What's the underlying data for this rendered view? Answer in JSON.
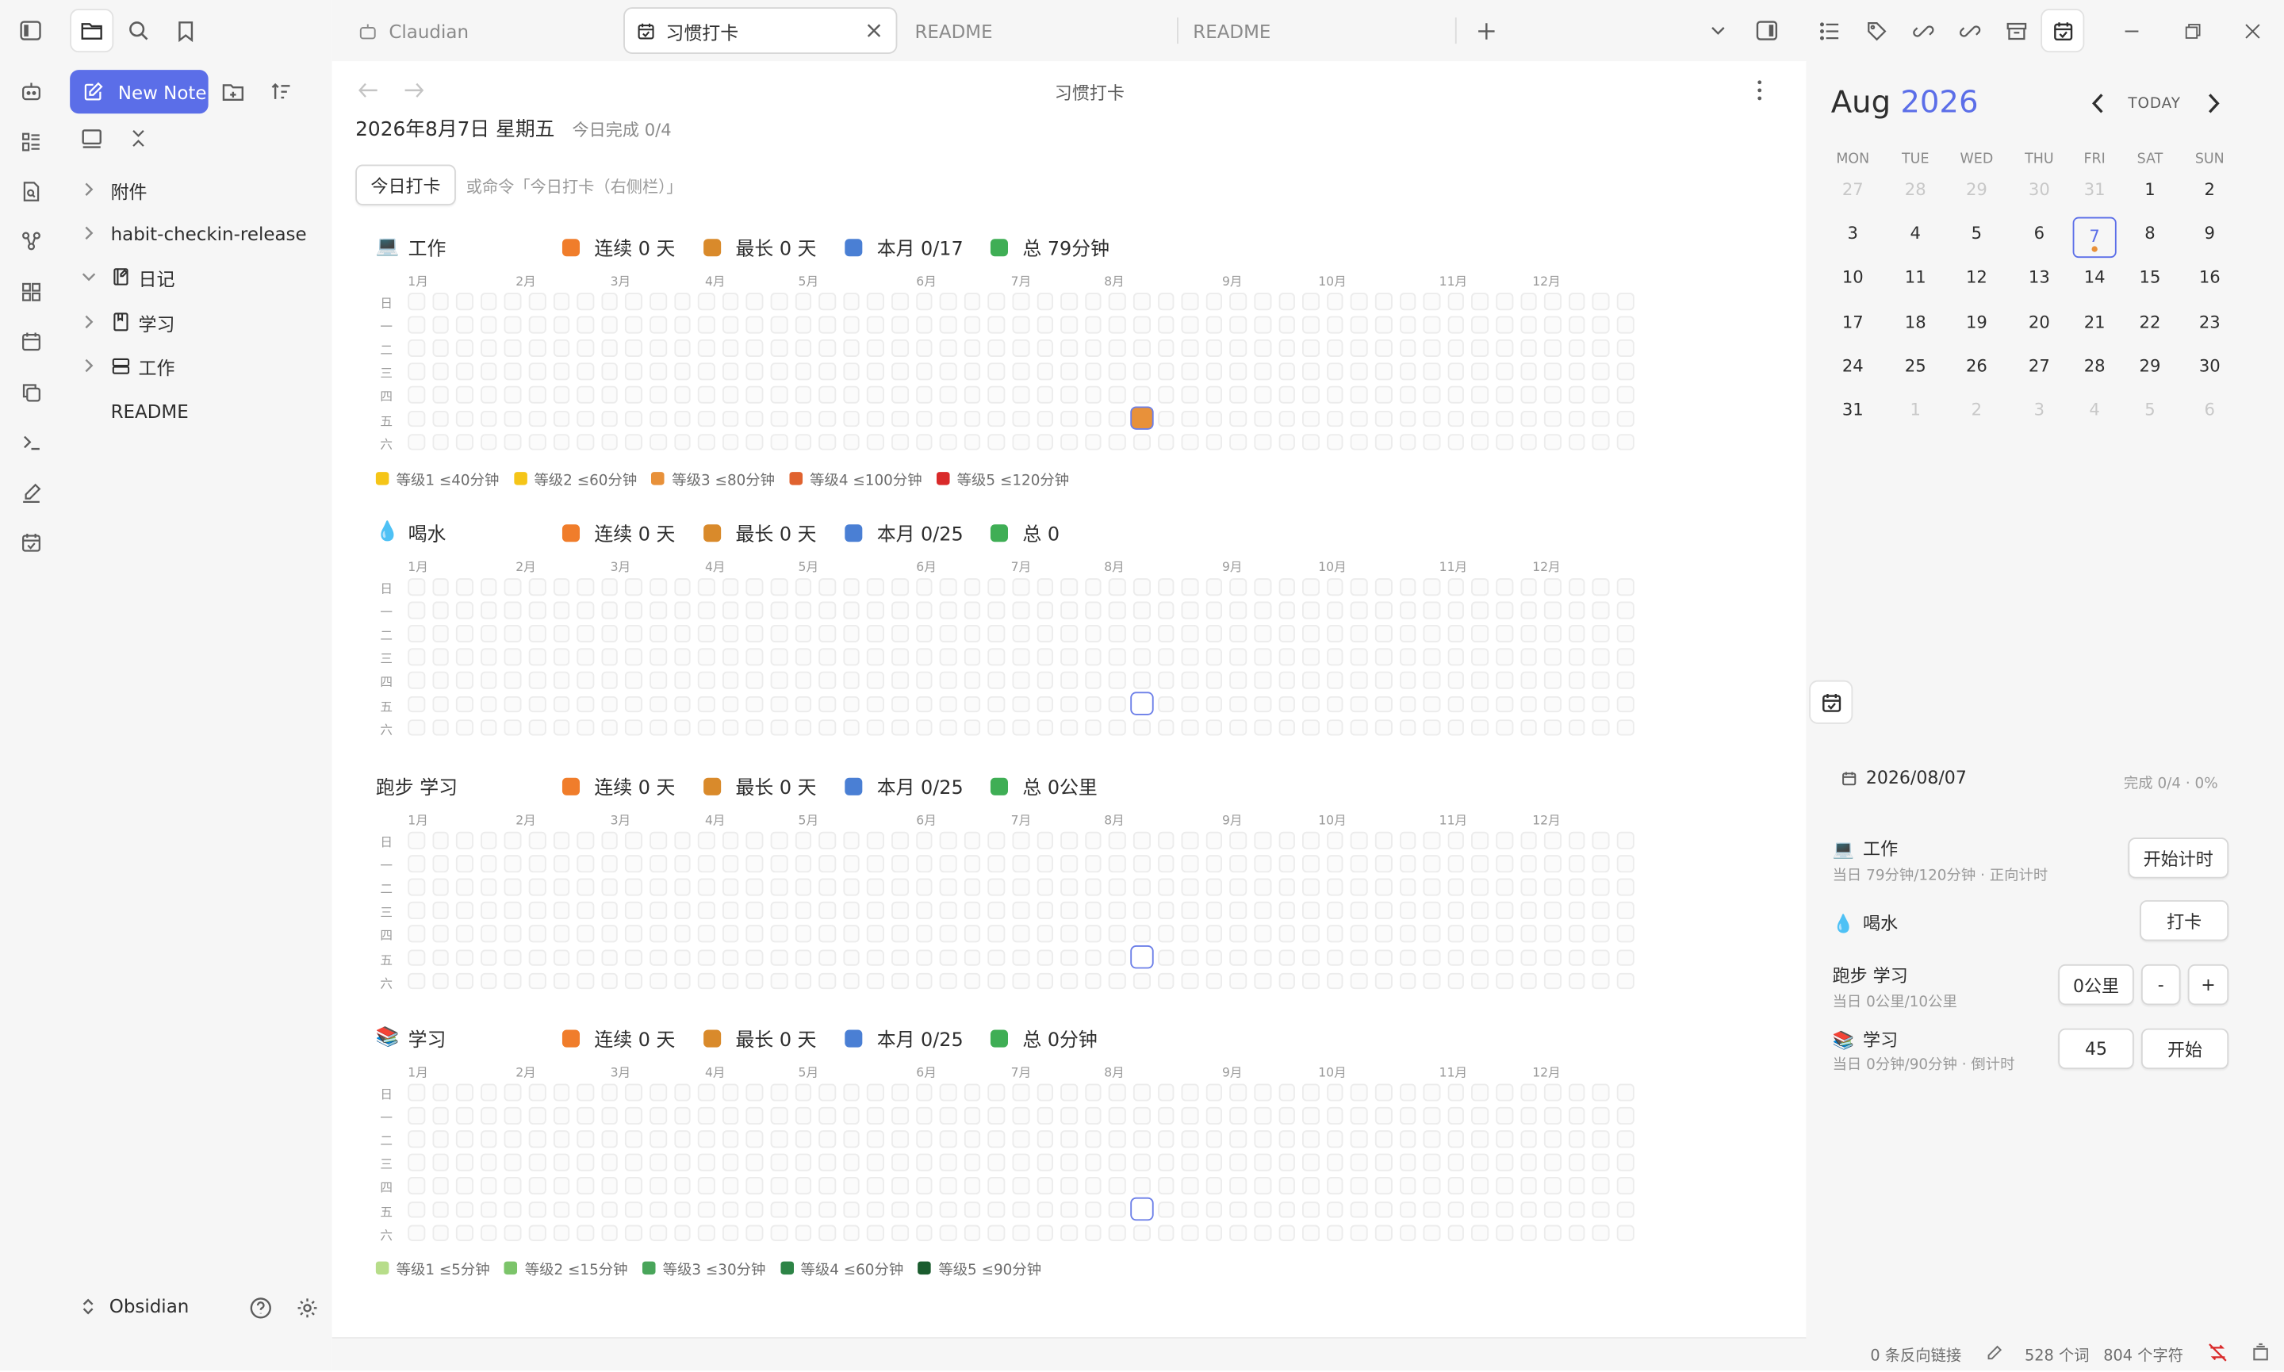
{
  "colors": {
    "accent": "#5b6ee8",
    "today_cell": "#e8913a",
    "today_border": "#6b7ee8"
  },
  "sidebar": {
    "new_note_label": "New Note",
    "tree": [
      {
        "label": "附件",
        "type": "folder",
        "expanded": false
      },
      {
        "label": "habit-checkin-release",
        "type": "folder",
        "expanded": false
      },
      {
        "label": "日记",
        "type": "folder",
        "expanded": true
      },
      {
        "label": "学习",
        "type": "folder",
        "expanded": false
      },
      {
        "label": "工作",
        "type": "folder",
        "expanded": false
      },
      {
        "label": "README",
        "type": "file"
      }
    ],
    "vault_name": "Obsidian"
  },
  "tabs": [
    {
      "label": "Claudian",
      "active": false
    },
    {
      "label": "习惯打卡",
      "active": true
    },
    {
      "label": "README",
      "active": false
    },
    {
      "label": "README",
      "active": false
    }
  ],
  "main": {
    "header_title": "习惯打卡",
    "date": "2026年8月7日 星期五",
    "today_done": "今日完成 0/4",
    "checkin_button": "今日打卡",
    "hint": "或命令「今日打卡（右侧栏）」",
    "months": [
      "1月",
      "2月",
      "3月",
      "4月",
      "5月",
      "6月",
      "7月",
      "8月",
      "9月",
      "10月",
      "11月",
      "12月"
    ],
    "days": [
      "日",
      "一",
      "二",
      "三",
      "四",
      "五",
      "六"
    ],
    "habits": [
      {
        "emoji": "💻",
        "name": "工作",
        "streak": "连续 0 天",
        "longest": "最长 0 天",
        "month": "本月 0/17",
        "total": "总 79分钟"
      },
      {
        "emoji": "💧",
        "name": "喝水",
        "streak": "连续 0 天",
        "longest": "最长 0 天",
        "month": "本月 0/25",
        "total": "总 0"
      },
      {
        "emoji": "",
        "name": "跑步 学习",
        "streak": "连续 0 天",
        "longest": "最长 0 天",
        "month": "本月 0/25",
        "total": "总 0公里"
      },
      {
        "emoji": "📚",
        "name": "学习",
        "streak": "连续 0 天",
        "longest": "最长 0 天",
        "month": "本月 0/25",
        "total": "总 0分钟"
      }
    ],
    "legend_work": [
      {
        "label": "等级1 ≤40分钟",
        "color": "#f5c518"
      },
      {
        "label": "等级2 ≤60分钟",
        "color": "#f5c518"
      },
      {
        "label": "等级3 ≤80分钟",
        "color": "#e8913a"
      },
      {
        "label": "等级4 ≤100分钟",
        "color": "#e0622f"
      },
      {
        "label": "等级5 ≤120分钟",
        "color": "#d92a2a"
      }
    ],
    "legend_study": [
      {
        "label": "等级1 ≤5分钟",
        "color": "#b7dd8a"
      },
      {
        "label": "等级2 ≤15分钟",
        "color": "#7cc46a"
      },
      {
        "label": "等级3 ≤30分钟",
        "color": "#49a55a"
      },
      {
        "label": "等级4 ≤60分钟",
        "color": "#2d8446"
      },
      {
        "label": "等级5 ≤90分钟",
        "color": "#1a5c2e"
      }
    ]
  },
  "calendar": {
    "month": "Aug",
    "year": "2026",
    "today_label": "TODAY",
    "weekdays": [
      "MON",
      "TUE",
      "WED",
      "THU",
      "FRI",
      "SAT",
      "SUN"
    ],
    "weeks": [
      [
        "27",
        "28",
        "29",
        "30",
        "31",
        "1",
        "2"
      ],
      [
        "3",
        "4",
        "5",
        "6",
        "7",
        "8",
        "9"
      ],
      [
        "10",
        "11",
        "12",
        "13",
        "14",
        "15",
        "16"
      ],
      [
        "17",
        "18",
        "19",
        "20",
        "21",
        "22",
        "23"
      ],
      [
        "24",
        "25",
        "26",
        "27",
        "28",
        "29",
        "30"
      ],
      [
        "31",
        "1",
        "2",
        "3",
        "4",
        "5",
        "6"
      ]
    ]
  },
  "panel": {
    "date": "2026/08/07",
    "progress": "完成 0/4 · 0%",
    "rows": [
      {
        "emoji": "💻",
        "name": "工作",
        "sub": "当日 79分钟/120分钟 · 正向计时",
        "button": "开始计时"
      },
      {
        "emoji": "💧",
        "name": "喝水",
        "sub": "",
        "button": "打卡"
      },
      {
        "emoji": "",
        "name": "跑步 学习",
        "sub": "当日 0公里/10公里",
        "value": "0公里",
        "minus": "-",
        "plus": "+"
      },
      {
        "emoji": "📚",
        "name": "学习",
        "sub": "当日 0分钟/90分钟 · 倒计时",
        "value": "45",
        "button": "开始"
      }
    ]
  },
  "status": {
    "backlinks": "0 条反向链接",
    "words": "528 个词",
    "chars": "804 个字符"
  }
}
